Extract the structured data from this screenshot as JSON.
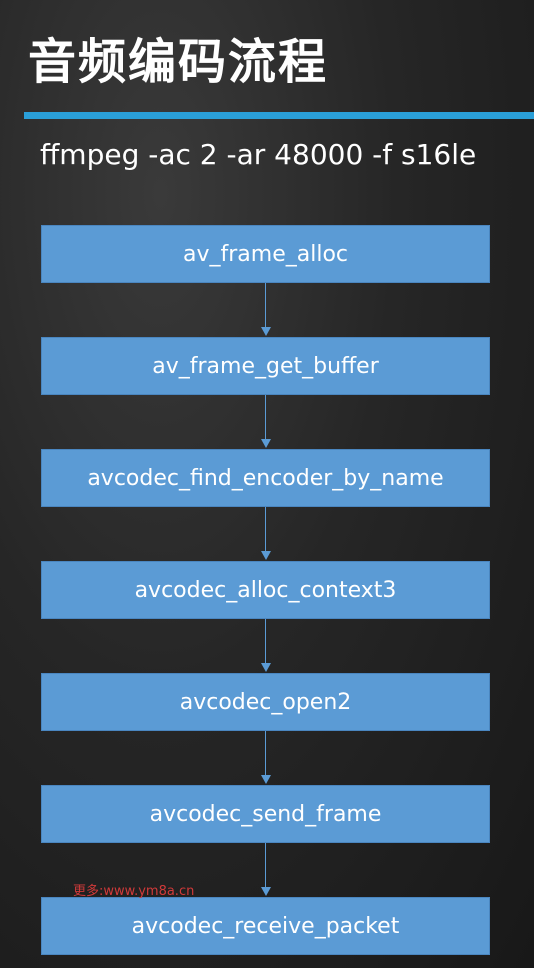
{
  "title": "音频编码流程",
  "command": "ffmpeg -ac 2 -ar 48000 -f s16le",
  "steps": [
    {
      "label": "av_frame_alloc"
    },
    {
      "label": "av_frame_get_buffer"
    },
    {
      "label": "avcodec_find_encoder_by_name"
    },
    {
      "label": "avcodec_alloc_context3"
    },
    {
      "label": "avcodec_open2"
    },
    {
      "label": "avcodec_send_frame"
    },
    {
      "label": "avcodec_receive_packet"
    }
  ],
  "watermark": "更多:www.ym8a.cn",
  "colors": {
    "accent_line": "#2a9fd8",
    "box_fill": "#5b9bd5",
    "watermark": "#d03a3a"
  }
}
